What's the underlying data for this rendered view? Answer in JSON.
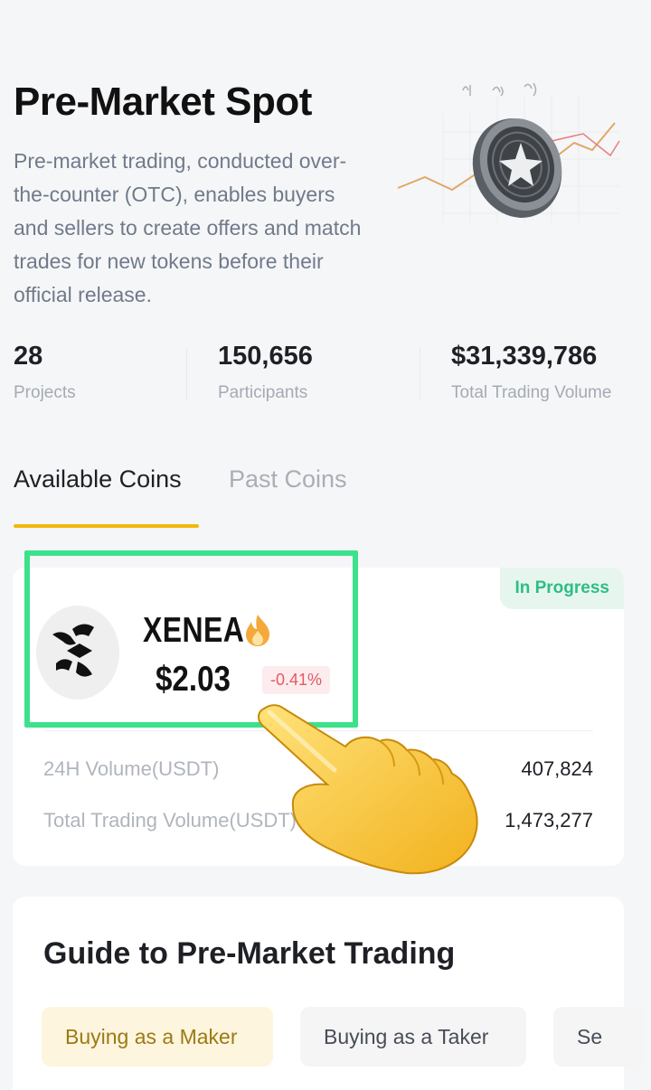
{
  "header": {
    "title": "Pre-Market Spot",
    "description": "Pre-market trading, conducted over-the-counter (OTC), enables buyers and sellers to create offers and match trades for new tokens before their official release."
  },
  "stats": [
    {
      "value": "28",
      "label": "Projects"
    },
    {
      "value": "150,656",
      "label": "Participants"
    },
    {
      "value": "$31,339,786",
      "label": "Total Trading Volume"
    }
  ],
  "tabs": [
    {
      "label": "Available Coins",
      "active": true
    },
    {
      "label": "Past Coins",
      "active": false
    }
  ],
  "coin": {
    "status": "In Progress",
    "name": "XENEA",
    "price": "$2.03",
    "change": "-0.41%",
    "metrics": [
      {
        "label": "24H Volume(USDT)",
        "value": "407,824"
      },
      {
        "label": "Total Trading Volume(USDT)",
        "value": "1,473,277"
      }
    ]
  },
  "guide": {
    "title": "Guide to Pre-Market Trading",
    "options": [
      {
        "label": "Buying as a Maker",
        "active": true
      },
      {
        "label": "Buying as a Taker",
        "active": false
      },
      {
        "label": "Se",
        "active": false
      }
    ]
  },
  "colors": {
    "accent": "#f0b90b",
    "positive": "#2ebd85",
    "negative": "#e35a61",
    "highlight": "#3ce28b"
  },
  "icons": [
    "coin-art-icon",
    "xenea-logo-icon",
    "fire-icon",
    "pointing-hand-icon"
  ]
}
